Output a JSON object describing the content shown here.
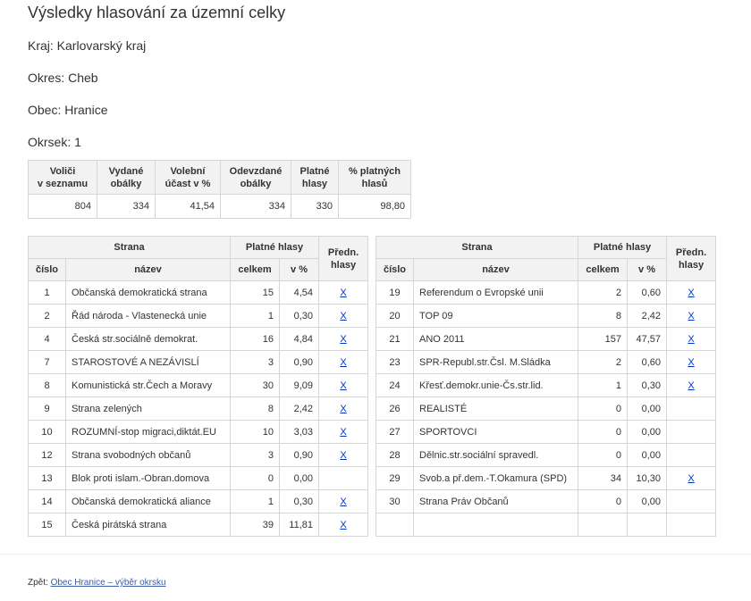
{
  "title": "Výsledky hlasování za územní celky",
  "info": {
    "kraj": "Kraj: Karlovarský kraj",
    "okres": "Okres: Cheb",
    "obec": "Obec: Hranice",
    "okrsek": "Okrsek: 1"
  },
  "summary": {
    "headers": [
      "Voliči\nv seznamu",
      "Vydané\nobálky",
      "Volební\núčast v %",
      "Odevzdané\nobálky",
      "Platné\nhlasy",
      "% platných\nhlasů"
    ],
    "values": [
      "804",
      "334",
      "41,54",
      "334",
      "330",
      "98,80"
    ]
  },
  "party_headers": {
    "strana": "Strana",
    "platne": "Platné hlasy",
    "predn": "Předn.\nhlasy",
    "cislo": "číslo",
    "nazev": "název",
    "celkem": "celkem",
    "procent": "v %"
  },
  "parties_left": [
    {
      "cislo": "1",
      "nazev": "Občanská demokratická strana",
      "celkem": "15",
      "procent": "4,54",
      "predn": "X"
    },
    {
      "cislo": "2",
      "nazev": "Řád národa - Vlastenecká unie",
      "celkem": "1",
      "procent": "0,30",
      "predn": "X"
    },
    {
      "cislo": "4",
      "nazev": "Česká str.sociálně demokrat.",
      "celkem": "16",
      "procent": "4,84",
      "predn": "X"
    },
    {
      "cislo": "7",
      "nazev": "STAROSTOVÉ A NEZÁVISLÍ",
      "celkem": "3",
      "procent": "0,90",
      "predn": "X"
    },
    {
      "cislo": "8",
      "nazev": "Komunistická str.Čech a Moravy",
      "celkem": "30",
      "procent": "9,09",
      "predn": "X"
    },
    {
      "cislo": "9",
      "nazev": "Strana zelených",
      "celkem": "8",
      "procent": "2,42",
      "predn": "X"
    },
    {
      "cislo": "10",
      "nazev": "ROZUMNÍ-stop migraci,diktát.EU",
      "celkem": "10",
      "procent": "3,03",
      "predn": "X"
    },
    {
      "cislo": "12",
      "nazev": "Strana svobodných občanů",
      "celkem": "3",
      "procent": "0,90",
      "predn": "X"
    },
    {
      "cislo": "13",
      "nazev": "Blok proti islam.-Obran.domova",
      "celkem": "0",
      "procent": "0,00",
      "predn": ""
    },
    {
      "cislo": "14",
      "nazev": "Občanská demokratická aliance",
      "celkem": "1",
      "procent": "0,30",
      "predn": "X"
    },
    {
      "cislo": "15",
      "nazev": "Česká pirátská strana",
      "celkem": "39",
      "procent": "11,81",
      "predn": "X"
    }
  ],
  "parties_right": [
    {
      "cislo": "19",
      "nazev": "Referendum o Evropské unii",
      "celkem": "2",
      "procent": "0,60",
      "predn": "X"
    },
    {
      "cislo": "20",
      "nazev": "TOP 09",
      "celkem": "8",
      "procent": "2,42",
      "predn": "X"
    },
    {
      "cislo": "21",
      "nazev": "ANO 2011",
      "celkem": "157",
      "procent": "47,57",
      "predn": "X"
    },
    {
      "cislo": "23",
      "nazev": "SPR-Republ.str.Čsl. M.Sládka",
      "celkem": "2",
      "procent": "0,60",
      "predn": "X"
    },
    {
      "cislo": "24",
      "nazev": "Křesť.demokr.unie-Čs.str.lid.",
      "celkem": "1",
      "procent": "0,30",
      "predn": "X"
    },
    {
      "cislo": "26",
      "nazev": "REALISTÉ",
      "celkem": "0",
      "procent": "0,00",
      "predn": ""
    },
    {
      "cislo": "27",
      "nazev": "SPORTOVCI",
      "celkem": "0",
      "procent": "0,00",
      "predn": ""
    },
    {
      "cislo": "28",
      "nazev": "Dělnic.str.sociální spravedl.",
      "celkem": "0",
      "procent": "0,00",
      "predn": ""
    },
    {
      "cislo": "29",
      "nazev": "Svob.a př.dem.-T.Okamura (SPD)",
      "celkem": "34",
      "procent": "10,30",
      "predn": "X"
    },
    {
      "cislo": "30",
      "nazev": "Strana Práv Občanů",
      "celkem": "0",
      "procent": "0,00",
      "predn": ""
    },
    {
      "cislo": "",
      "nazev": "",
      "celkem": "",
      "procent": "",
      "predn": ""
    }
  ],
  "footer": {
    "label": "Zpět:",
    "link": "Obec Hranice – výběr okrsku"
  },
  "colors": {
    "link": "#0033cc",
    "header_bg": "#f2f2f2",
    "border": "#d6d6d6"
  }
}
